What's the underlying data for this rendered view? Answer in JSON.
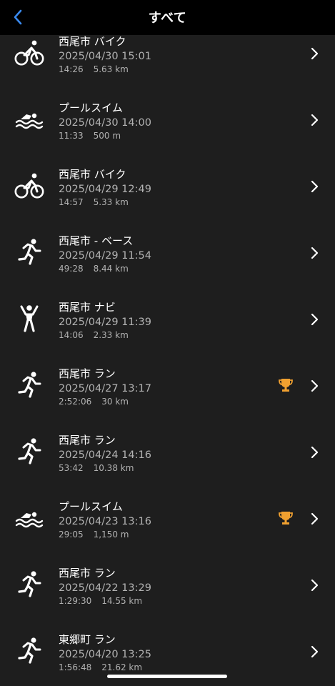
{
  "header": {
    "title": "すべて",
    "back_icon": "chevron-left-icon"
  },
  "colors": {
    "accent": "#3a8af0",
    "trophy": "#f0a030",
    "background": "#1e1e1e",
    "secondary_text": "#b2b2b2"
  },
  "activities": [
    {
      "type": "bike",
      "icon": "bike-icon",
      "title": "西尾市 バイク",
      "date": "2025/04/30 15:01",
      "time": "14:26",
      "distance": "5.63 km",
      "trophy": false
    },
    {
      "type": "swim",
      "icon": "swim-icon",
      "title": "プールスイム",
      "date": "2025/04/30 14:00",
      "time": "11:33",
      "distance": "500 m",
      "trophy": false
    },
    {
      "type": "bike",
      "icon": "bike-icon",
      "title": "西尾市 バイク",
      "date": "2025/04/29 12:49",
      "time": "14:57",
      "distance": "5.33 km",
      "trophy": false
    },
    {
      "type": "run",
      "icon": "run-icon",
      "title": "西尾市 - ベース",
      "date": "2025/04/29 11:54",
      "time": "49:28",
      "distance": "8.44 km",
      "trophy": false
    },
    {
      "type": "navi",
      "icon": "person-icon",
      "title": "西尾市 ナビ",
      "date": "2025/04/29 11:39",
      "time": "14:06",
      "distance": "2.33 km",
      "trophy": false
    },
    {
      "type": "run",
      "icon": "run-icon",
      "title": "西尾市 ラン",
      "date": "2025/04/27 13:17",
      "time": "2:52:06",
      "distance": "30 km",
      "trophy": true
    },
    {
      "type": "run",
      "icon": "run-icon",
      "title": "西尾市 ラン",
      "date": "2025/04/24 14:16",
      "time": "53:42",
      "distance": "10.38 km",
      "trophy": false
    },
    {
      "type": "swim",
      "icon": "swim-icon",
      "title": "プールスイム",
      "date": "2025/04/23 13:16",
      "time": "29:05",
      "distance": "1,150 m",
      "trophy": true
    },
    {
      "type": "run",
      "icon": "run-icon",
      "title": "西尾市 ラン",
      "date": "2025/04/22 13:29",
      "time": "1:29:30",
      "distance": "14.55 km",
      "trophy": false
    },
    {
      "type": "run",
      "icon": "run-icon",
      "title": "東郷町 ラン",
      "date": "2025/04/20 13:25",
      "time": "1:56:48",
      "distance": "21.62 km",
      "trophy": false
    }
  ]
}
